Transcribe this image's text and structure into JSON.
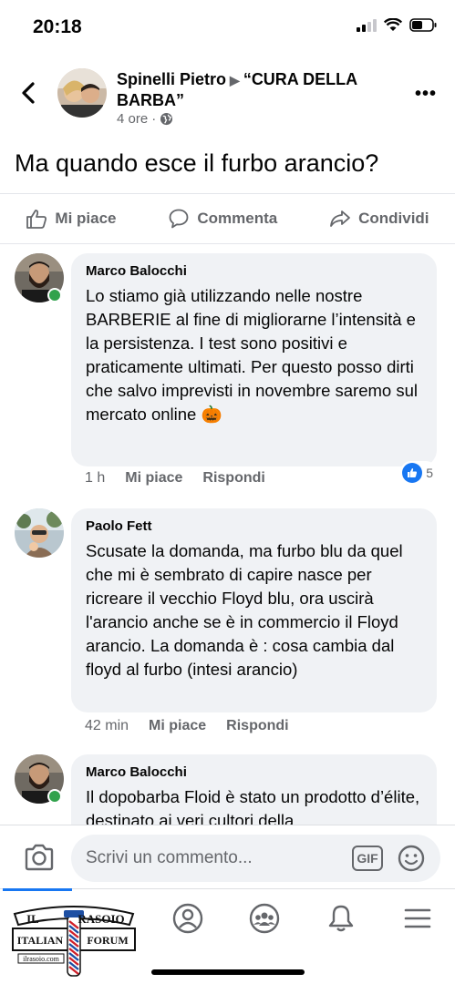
{
  "status_bar": {
    "time": "20:18"
  },
  "post": {
    "author": "Spinelli Pietro",
    "group": "“CURA DELLA BARBA”",
    "time": "4 ore",
    "text": "Ma quando esce il furbo arancio?"
  },
  "actions": {
    "like": "Mi piace",
    "comment": "Commenta",
    "share": "Condividi"
  },
  "comments": [
    {
      "author": "Marco Balocchi",
      "text": "Lo stiamo già utilizzando nelle nostre BARBERIE al fine di migliorarne l’intensità e la persistenza. I test sono positivi e praticamente ultimati. Per questo posso dirti che salvo imprevisti in novembre saremo sul mercato online 🎃",
      "time": "1 h",
      "like": "Mi piace",
      "reply": "Rispondi",
      "reactions": "5"
    },
    {
      "author": "Paolo Fett",
      "text": "Scusate la domanda, ma furbo blu da quel che mi è sembrato di capire nasce per ricreare il vecchio Floyd blu, ora uscirà l'arancio anche se è in commercio il Floyd arancio. La domanda è : cosa cambia dal floyd al furbo (intesi arancio)",
      "time": "42 min",
      "like": "Mi piace",
      "reply": "Rispondi"
    },
    {
      "author": "Marco Balocchi",
      "text": "Il dopobarba Floid è stato un prodotto d’élite, destinato ai veri cultori della"
    }
  ],
  "composer": {
    "placeholder": "Scrivi un commento...",
    "gif": "GIF"
  },
  "watermark": {
    "line1": "IL RASOIO",
    "line2": "ITALIAN FORUM",
    "site": "ilrasoio.com"
  },
  "colors": {
    "accent": "#1877f2",
    "online": "#31a24c",
    "bubble": "#f0f2f5",
    "muted": "#65676b"
  },
  "icons": [
    "back-arrow-icon",
    "globe-icon",
    "more-icon",
    "like-icon",
    "comment-icon",
    "share-icon",
    "camera-icon",
    "gif-icon",
    "emoji-icon",
    "profile-icon",
    "groups-icon",
    "bell-icon",
    "menu-icon"
  ]
}
